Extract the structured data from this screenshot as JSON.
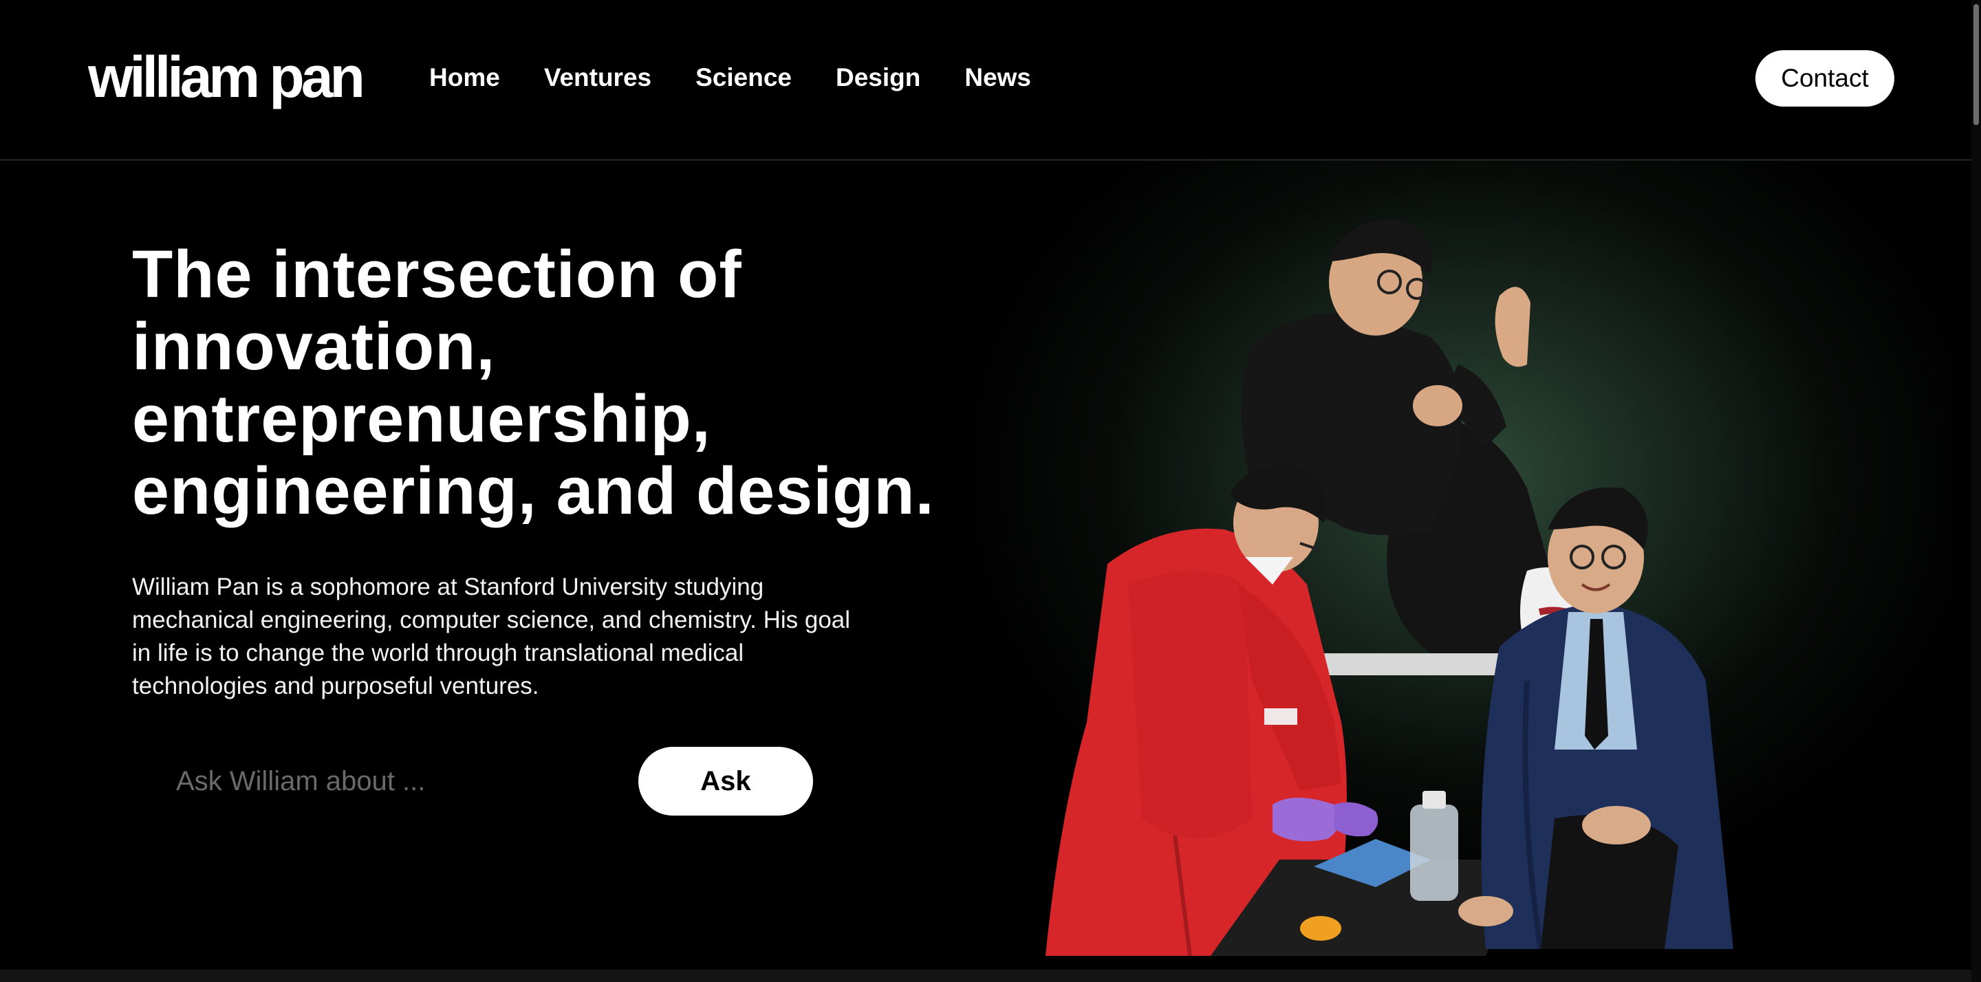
{
  "header": {
    "logo": "william pan",
    "nav": [
      {
        "label": "Home"
      },
      {
        "label": "Ventures"
      },
      {
        "label": "Science"
      },
      {
        "label": "Design"
      },
      {
        "label": "News"
      }
    ],
    "contact_label": "Contact"
  },
  "hero": {
    "headline": "The intersection of innovation, entreprenuership, engineering, and design.",
    "intro": "William Pan is a sophomore at Stanford University studying mechanical engineering, computer science, and chemistry. His goal in life is to change the world through translational medical technologies and purposeful ventures.",
    "ask_placeholder": "Ask William about ...",
    "ask_label": "Ask"
  },
  "colors": {
    "background": "#000000",
    "accent_glow": "#2e4a38",
    "button_bg": "#ffffff",
    "button_text": "#000000",
    "lab_coat": "#d9262a",
    "glove": "#9b6bd8",
    "graduation_gown": "#1e2f5a"
  }
}
